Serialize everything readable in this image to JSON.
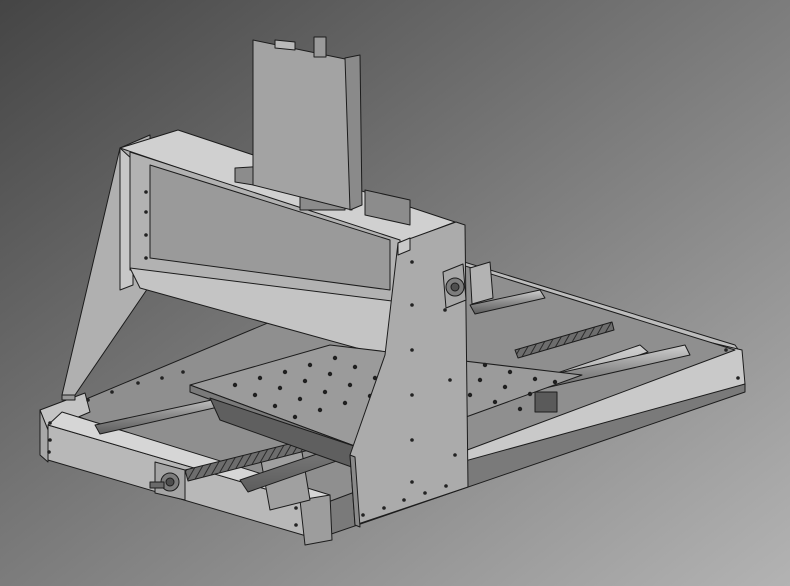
{
  "viewport": {
    "background_top": "#4a4a4a",
    "background_bottom": "#aaaaaa",
    "edge_color": "#1c1c1c"
  },
  "model": {
    "parts": [
      "base-frame",
      "x-axis-rail-left",
      "x-axis-rail-right",
      "x-axis-lead-screw",
      "front-stepper-motor-mount",
      "worktable-plate",
      "gantry-side-plate-left",
      "gantry-side-plate-right",
      "gantry-crossbeam",
      "y-axis-stepper-motor-mount",
      "z-axis-carriage",
      "z-axis-spindle-plate"
    ]
  }
}
